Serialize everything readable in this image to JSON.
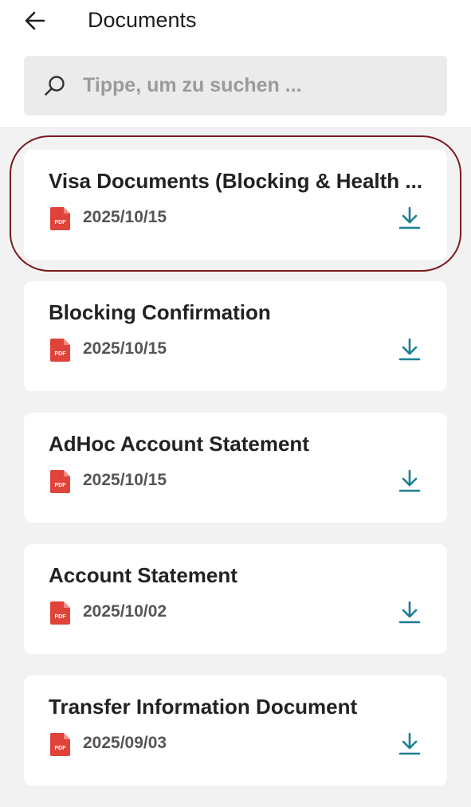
{
  "header": {
    "title": "Documents",
    "back_icon": "arrow-left-icon"
  },
  "search": {
    "placeholder": "Tippe, um zu suchen ...",
    "value": "",
    "icon": "search-icon"
  },
  "documents": [
    {
      "title": "Visa Documents (Blocking & Health ...",
      "date": "2025/10/15",
      "file_type": "PDF",
      "highlighted": true
    },
    {
      "title": "Blocking Confirmation",
      "date": "2025/10/15",
      "file_type": "PDF"
    },
    {
      "title": "AdHoc Account Statement",
      "date": "2025/10/15",
      "file_type": "PDF"
    },
    {
      "title": "Account Statement",
      "date": "2025/10/02",
      "file_type": "PDF"
    },
    {
      "title": "Transfer Information Document",
      "date": "2025/09/03",
      "file_type": "PDF"
    }
  ],
  "colors": {
    "accent": "#1b7f93",
    "pdf_red": "#e0433a",
    "highlight_ring": "#7a1a1e",
    "background": "#f2f2f2"
  }
}
